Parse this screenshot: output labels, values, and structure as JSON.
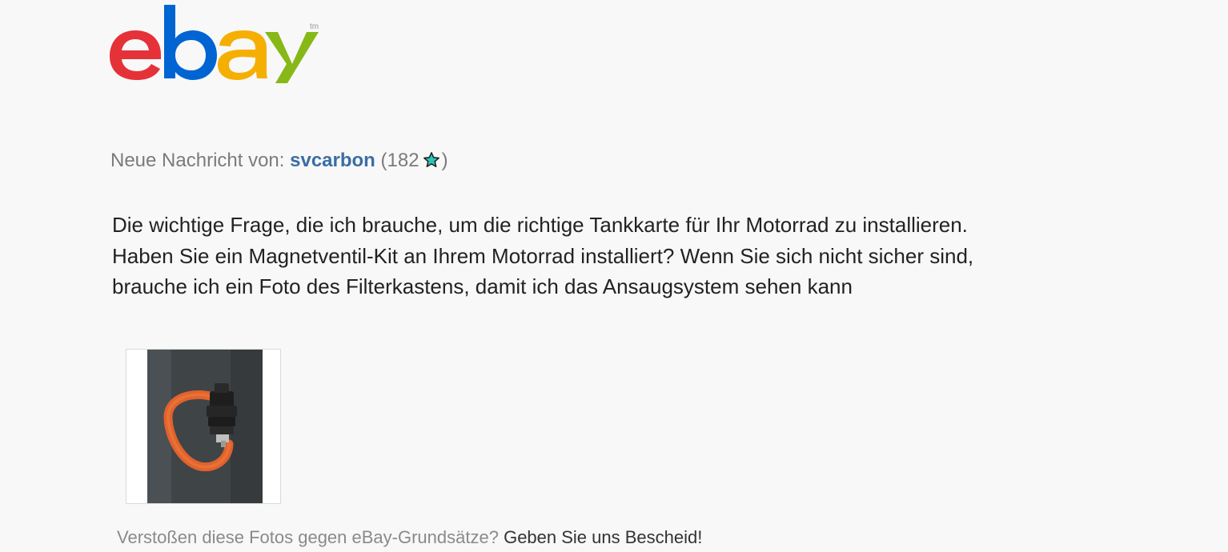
{
  "logo": {
    "letters": [
      "e",
      "b",
      "a",
      "y"
    ],
    "trademark": "tm",
    "colors": [
      "#e53238",
      "#0064d2",
      "#f5af02",
      "#86b817"
    ]
  },
  "sender": {
    "prefix": "Neue Nachricht von:",
    "name": "svcarbon",
    "open_paren": "(182",
    "close_paren": ")",
    "star_icon": "turquoise-star-icon",
    "star_color": "#2ec4b6"
  },
  "message": {
    "lines": [
      "Die wichtige Frage, die ich brauche, um die richtige Tankkarte für Ihr Motorrad zu installieren.",
      "Haben Sie ein Magnetventil-Kit an Ihrem Motorrad installiert? Wenn Sie sich nicht sicher sind,",
      "brauche ich ein Foto des Filterkastens, damit ich das Ansaugsystem sehen kann"
    ]
  },
  "photo": {
    "icon": "photo-thumbnail"
  },
  "report": {
    "question": "Verstoßen diese Fotos gegen eBay-Grundsätze?",
    "link": "Geben Sie uns Bescheid!"
  }
}
